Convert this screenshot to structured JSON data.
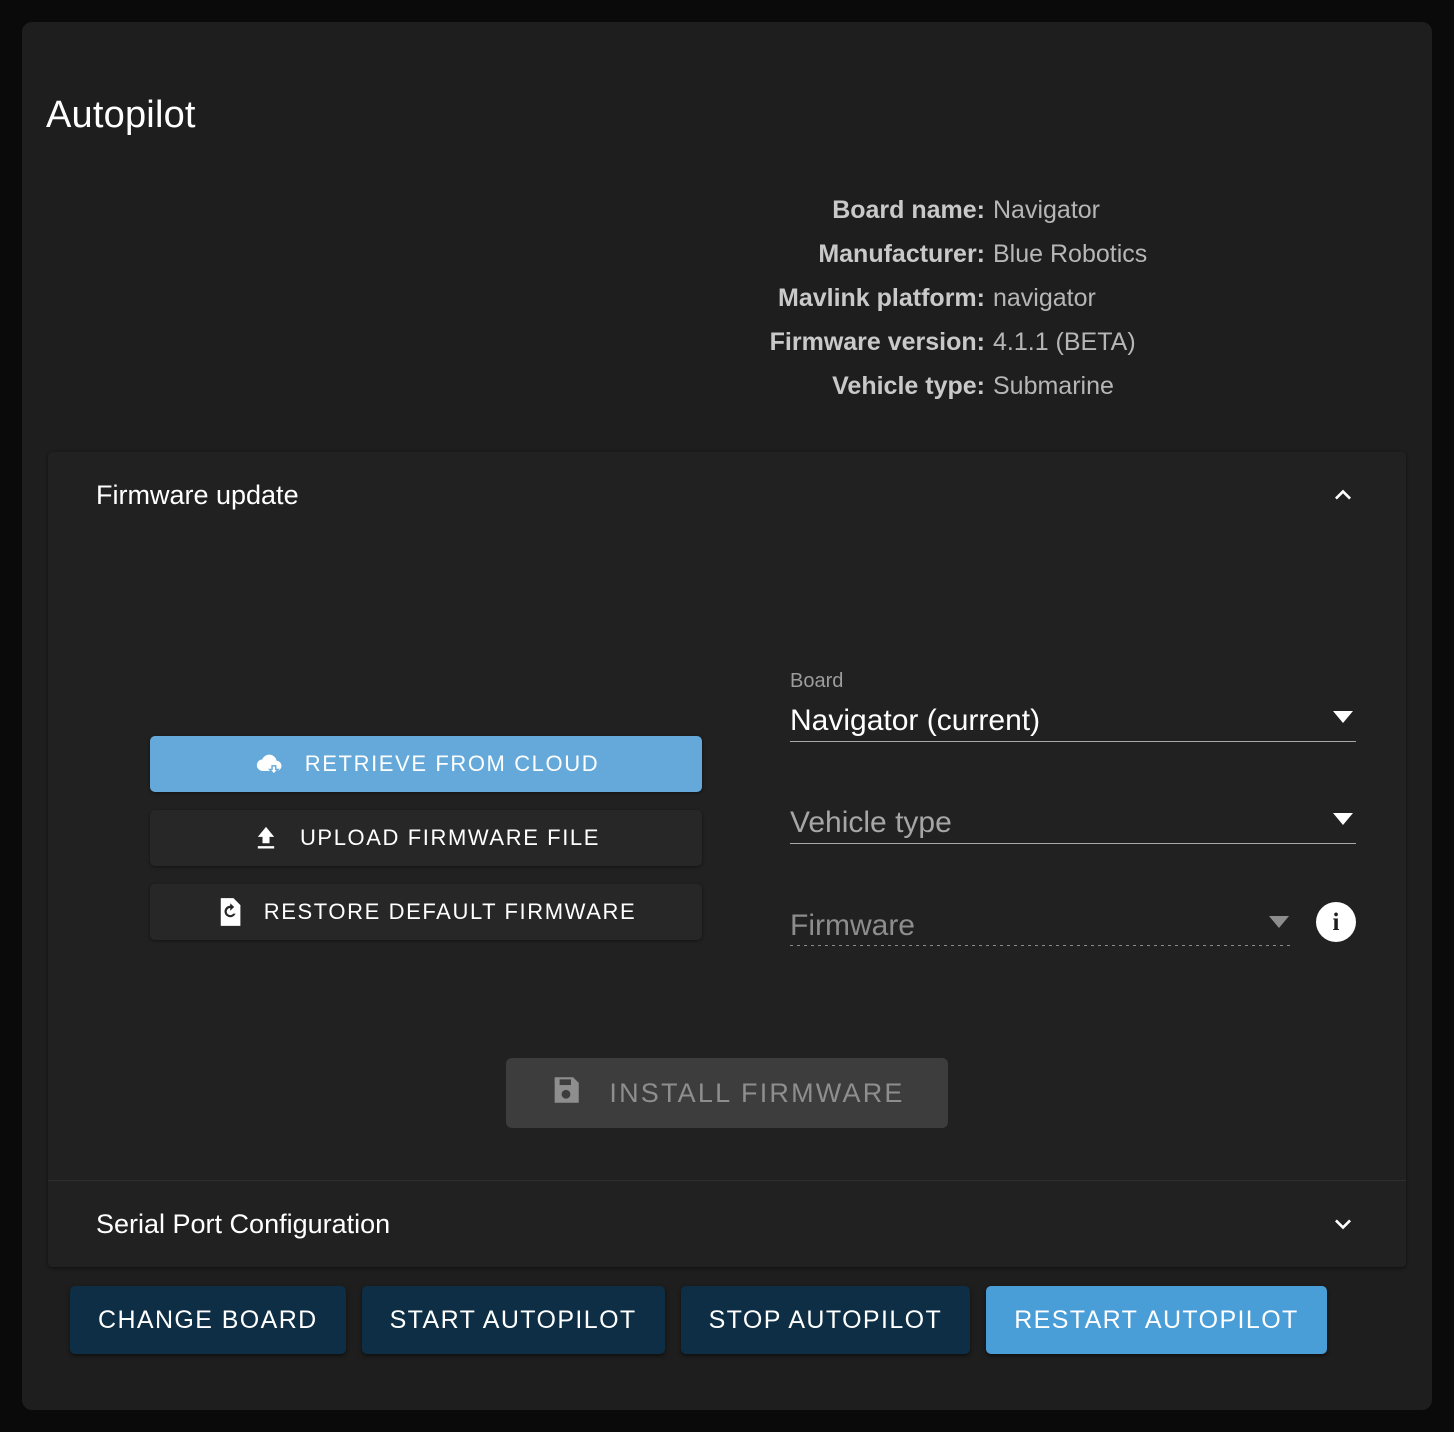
{
  "page": {
    "title": "Autopilot"
  },
  "board_info": [
    {
      "key": "Board name:",
      "value": "Navigator"
    },
    {
      "key": "Manufacturer:",
      "value": "Blue Robotics"
    },
    {
      "key": "Mavlink platform:",
      "value": "navigator"
    },
    {
      "key": "Firmware version:",
      "value": "4.1.1 (BETA)"
    },
    {
      "key": "Vehicle type:",
      "value": "Submarine"
    }
  ],
  "firmware_panel": {
    "title": "Firmware update",
    "expanded": true,
    "chevron_icon": "chevron-up-icon",
    "buttons": [
      {
        "label": "RETRIEVE FROM CLOUD",
        "icon": "cloud-download-icon",
        "style": "primary"
      },
      {
        "label": "UPLOAD FIRMWARE FILE",
        "icon": "upload-icon",
        "style": "default"
      },
      {
        "label": "RESTORE DEFAULT FIRMWARE",
        "icon": "file-restore-icon",
        "style": "default"
      }
    ],
    "fields": {
      "board": {
        "label": "Board",
        "value": "Navigator (current)",
        "arrow_icon": "dropdown-arrow-icon",
        "disabled": false
      },
      "vehicle_type": {
        "label": "",
        "value": "Vehicle type",
        "arrow_icon": "dropdown-arrow-icon",
        "disabled": false
      },
      "firmware": {
        "label": "",
        "value": "Firmware",
        "arrow_icon": "dropdown-arrow-icon",
        "disabled": true,
        "info_icon": "info-icon",
        "info_badge_glyph": "i"
      }
    },
    "install_button": {
      "label": "INSTALL FIRMWARE",
      "icon": "save-icon",
      "disabled": true
    }
  },
  "serial_panel": {
    "title": "Serial Port Configuration",
    "expanded": false,
    "chevron_icon": "chevron-down-icon"
  },
  "bottom_actions": [
    {
      "label": "CHANGE BOARD",
      "style": "default"
    },
    {
      "label": "START AUTOPILOT",
      "style": "default"
    },
    {
      "label": "STOP AUTOPILOT",
      "style": "default"
    },
    {
      "label": "RESTART AUTOPILOT",
      "style": "accent"
    }
  ],
  "colors": {
    "page_background": "#0a0a0a",
    "card_background": "#1e1e1e",
    "panel_background": "#212121",
    "accent_blue": "#4a9ed8",
    "primary_button_blue": "#64a9da",
    "bar_button_navy": "#0d2e44",
    "text_primary": "#ffffff",
    "text_secondary": "#b6b6b6",
    "text_disabled": "#8e8e8e"
  }
}
